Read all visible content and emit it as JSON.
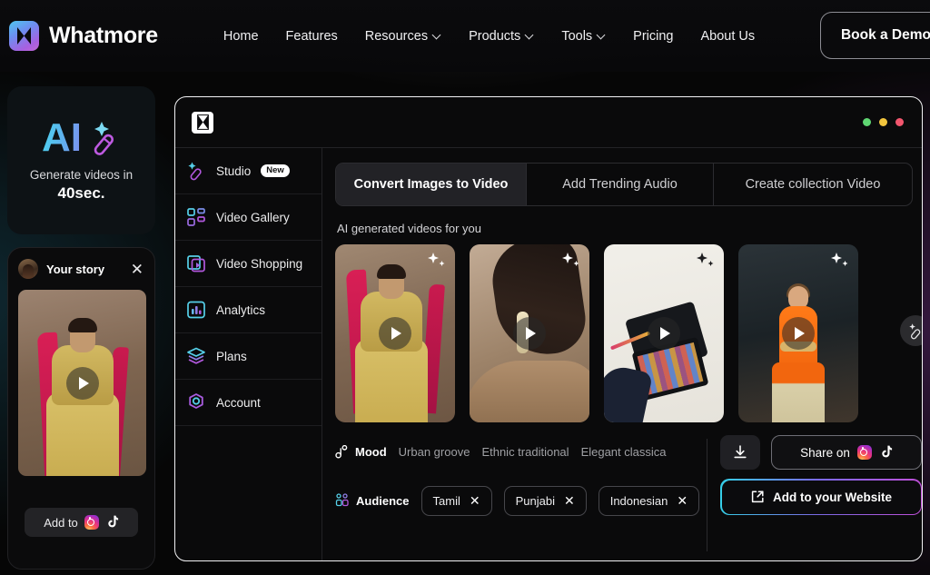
{
  "nav": {
    "brand": "Whatmore",
    "brand_icon": "whatmore-logo-icon",
    "links": [
      {
        "label": "Home",
        "has_caret": false
      },
      {
        "label": "Features",
        "has_caret": false
      },
      {
        "label": "Resources",
        "has_caret": true
      },
      {
        "label": "Products",
        "has_caret": true
      },
      {
        "label": "Tools",
        "has_caret": true
      },
      {
        "label": "Pricing",
        "has_caret": false
      },
      {
        "label": "About Us",
        "has_caret": false
      }
    ],
    "cta_label": "Book a Demo"
  },
  "promo": {
    "ai_text": "AI",
    "wand_icon": "magic-wand-icon",
    "line1": "Generate videos in",
    "line2": "40sec."
  },
  "story": {
    "title": "Your story",
    "close_icon": "close-icon",
    "avatar_icon": "avatar",
    "play_icon": "play-icon",
    "cta_label": "Add to",
    "instagram_icon": "instagram-icon",
    "tiktok_icon": "tiktok-icon"
  },
  "app": {
    "logo_icon": "whatmore-mark-icon",
    "window_dots": [
      {
        "name": "minimize-dot",
        "color": "#5fd672"
      },
      {
        "name": "maximize-dot",
        "color": "#f2c53d"
      },
      {
        "name": "close-dot",
        "color": "#f2566e"
      }
    ],
    "sidebar": [
      {
        "label": "Studio",
        "icon": "magic-wand-icon",
        "badge": "New"
      },
      {
        "label": "Video Gallery",
        "icon": "grid-icon",
        "badge": ""
      },
      {
        "label": "Video Shopping",
        "icon": "video-play-icon",
        "badge": ""
      },
      {
        "label": "Analytics",
        "icon": "bar-chart-icon",
        "badge": ""
      },
      {
        "label": "Plans",
        "icon": "layers-icon",
        "badge": ""
      },
      {
        "label": "Account",
        "icon": "settings-gear-icon",
        "badge": ""
      }
    ],
    "tabs": [
      {
        "label": "Convert Images to Video",
        "active": true
      },
      {
        "label": "Add Trending Audio",
        "active": false
      },
      {
        "label": "Create collection Video",
        "active": false
      }
    ],
    "section_label": "AI generated videos for you",
    "thumbnails": [
      {
        "name": "video-thumbnail-bride",
        "sparkle_icon": "sparkle-icon",
        "play_icon": "play-icon"
      },
      {
        "name": "video-thumbnail-earring",
        "sparkle_icon": "sparkle-icon",
        "play_icon": "play-icon"
      },
      {
        "name": "video-thumbnail-makeup-palette",
        "sparkle_icon": "sparkle-icon",
        "play_icon": "play-icon"
      },
      {
        "name": "video-thumbnail-orange-kurta",
        "sparkle_icon": "sparkle-icon",
        "play_icon": "play-icon"
      }
    ],
    "wand_fab_icon": "magic-wand-icon",
    "mood": {
      "label": "Mood",
      "icon": "music-note-icon",
      "options": [
        "Urban groove",
        "Ethnic traditional",
        "Elegant classica"
      ]
    },
    "audience": {
      "label": "Audience",
      "icon": "audience-group-icon",
      "chips": [
        {
          "label": "Tamil",
          "remove_icon": "close-icon"
        },
        {
          "label": "Punjabi",
          "remove_icon": "close-icon"
        },
        {
          "label": "Indonesian",
          "remove_icon": "close-icon"
        }
      ]
    },
    "actions": {
      "download_icon": "download-icon",
      "share_label": "Share on",
      "instagram_icon": "instagram-icon",
      "tiktok_icon": "tiktok-icon",
      "website_label": "Add to your Website",
      "website_icon": "external-link-icon"
    }
  },
  "colors": {
    "accent_cyan": "#35d0e8",
    "accent_purple": "#c04fd8",
    "tab_active_bg": "#222226",
    "page_bg": "#060606"
  }
}
